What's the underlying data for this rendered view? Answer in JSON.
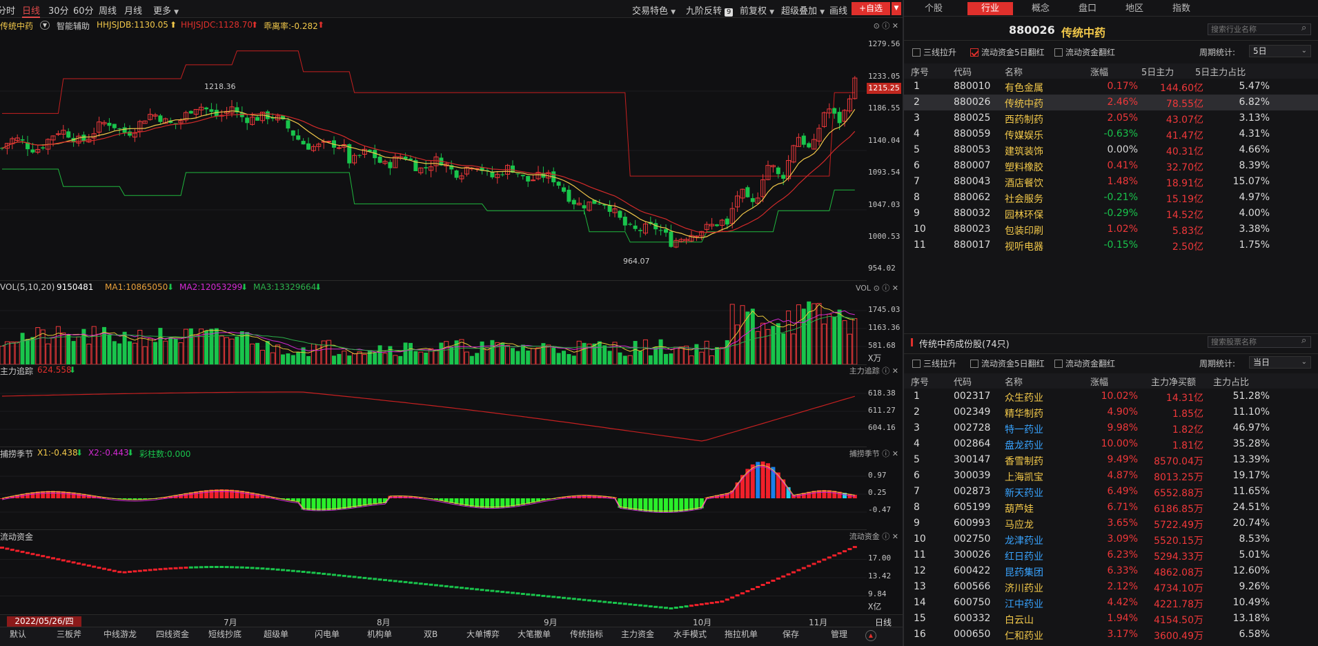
{
  "toolbar": {
    "periods": [
      "分时",
      "日线",
      "30分",
      "60分",
      "周线",
      "月线",
      "更多"
    ],
    "active_period": "日线",
    "right_items": [
      "交易特色",
      "九阶反转",
      "前复权",
      "超级叠加",
      "画线"
    ],
    "badge": "9",
    "add_fav": "+自选"
  },
  "kline": {
    "name": "传统中药",
    "assist": "智能辅助",
    "hh1": "HHJSJDB:1130.05",
    "hh2": "HHJSJDC:1128.70",
    "bias": "乖离率:-0.282",
    "axis": [
      "1279.56",
      "1233.05",
      "1186.55",
      "1140.04",
      "1093.54",
      "1047.03",
      "1000.53",
      "954.02"
    ],
    "current": "1215.25",
    "high_label": "1218.36",
    "low_label": "964.07"
  },
  "vol": {
    "title": "VOL(5,10,20)",
    "value": "9150481",
    "ma1": "MA1:10865050",
    "ma2": "MA2:12053299",
    "ma3": "MA3:13329664",
    "tag": "VOL",
    "axis": [
      "1745.03",
      "1163.36",
      "581.68"
    ],
    "unit": "X万"
  },
  "trace": {
    "title": "主力追踪",
    "value": "624.558",
    "tag": "主力追踪",
    "axis": [
      "618.38",
      "611.27",
      "604.16"
    ]
  },
  "season": {
    "title": "捕捞季节",
    "x1": "X1:-0.438",
    "x2": "X2:-0.443",
    "bars": "彩柱数:0.000",
    "tag": "捕捞季节",
    "axis": [
      "0.97",
      "0.25",
      "-0.47"
    ]
  },
  "flow": {
    "title": "流动资金",
    "tag": "流动资金",
    "axis": [
      "17.00",
      "13.42",
      "9.84"
    ],
    "unit": "X亿"
  },
  "xaxis": {
    "date": "2022/05/26/四",
    "months": [
      "7月",
      "8月",
      "9月",
      "10月",
      "11月"
    ],
    "period": "日线"
  },
  "bottom_tabs": [
    "默认",
    "三板斧",
    "中线游龙",
    "四线资金",
    "短线抄底",
    "超级单",
    "闪电单",
    "机构单",
    "双B",
    "大单博弈",
    "大笔撤单",
    "传统指标",
    "主力资金",
    "水手模式",
    "拖拉机单",
    "保存",
    "管理"
  ],
  "right": {
    "tabs": [
      "个股",
      "行业",
      "概念",
      "盘口",
      "地区",
      "指数"
    ],
    "active_tab": "行业",
    "code": "880026",
    "name": "传统中药",
    "search_industry": "搜索行业名称",
    "cb1": [
      "三线拉升",
      "流动资金5日翻红",
      "流动资金翻红"
    ],
    "period_label": "周期统计:",
    "period_value": "5日",
    "headers": [
      "序号",
      "代码",
      "名称",
      "涨幅",
      "5日主力",
      "5日主力占比"
    ],
    "rows": [
      {
        "no": "1",
        "code": "880010",
        "name": "有色金属",
        "chg": "0.17%",
        "main": "144.60亿",
        "ratio": "5.47%",
        "dir": "up"
      },
      {
        "no": "2",
        "code": "880026",
        "name": "传统中药",
        "chg": "2.46%",
        "main": "78.55亿",
        "ratio": "6.82%",
        "dir": "up"
      },
      {
        "no": "3",
        "code": "880025",
        "name": "西药制药",
        "chg": "2.05%",
        "main": "43.07亿",
        "ratio": "3.13%",
        "dir": "up"
      },
      {
        "no": "4",
        "code": "880059",
        "name": "传媒娱乐",
        "chg": "-0.63%",
        "main": "41.47亿",
        "ratio": "4.31%",
        "dir": "dn"
      },
      {
        "no": "5",
        "code": "880053",
        "name": "建筑装饰",
        "chg": "0.00%",
        "main": "40.31亿",
        "ratio": "4.66%",
        "dir": "zr"
      },
      {
        "no": "6",
        "code": "880007",
        "name": "塑料橡胶",
        "chg": "0.41%",
        "main": "32.70亿",
        "ratio": "8.39%",
        "dir": "up"
      },
      {
        "no": "7",
        "code": "880043",
        "name": "酒店餐饮",
        "chg": "1.48%",
        "main": "18.91亿",
        "ratio": "15.07%",
        "dir": "up"
      },
      {
        "no": "8",
        "code": "880062",
        "name": "社会服务",
        "chg": "-0.21%",
        "main": "15.19亿",
        "ratio": "4.97%",
        "dir": "dn"
      },
      {
        "no": "9",
        "code": "880032",
        "name": "园林环保",
        "chg": "-0.29%",
        "main": "14.52亿",
        "ratio": "4.00%",
        "dir": "dn"
      },
      {
        "no": "10",
        "code": "880023",
        "name": "包装印刷",
        "chg": "1.02%",
        "main": "5.83亿",
        "ratio": "3.38%",
        "dir": "up"
      },
      {
        "no": "11",
        "code": "880017",
        "name": "视听电器",
        "chg": "-0.15%",
        "main": "2.50亿",
        "ratio": "1.75%",
        "dir": "dn"
      }
    ],
    "constituents_title": "传统中药成份股(74只)",
    "search_stock": "搜索股票名称",
    "cb2": [
      "三线拉升",
      "流动资金5日翻红",
      "流动资金翻红"
    ],
    "period2_value": "当日",
    "headers2": [
      "序号",
      "代码",
      "名称",
      "涨幅",
      "主力净买额",
      "主力占比"
    ],
    "rows2": [
      {
        "no": "1",
        "code": "002317",
        "name": "众生药业",
        "chg": "10.02%",
        "main": "14.31亿",
        "ratio": "51.28%",
        "nc": "yl"
      },
      {
        "no": "2",
        "code": "002349",
        "name": "精华制药",
        "chg": "4.90%",
        "main": "1.85亿",
        "ratio": "11.10%",
        "nc": "yl"
      },
      {
        "no": "3",
        "code": "002728",
        "name": "特一药业",
        "chg": "9.98%",
        "main": "1.82亿",
        "ratio": "46.97%",
        "nc": "bl"
      },
      {
        "no": "4",
        "code": "002864",
        "name": "盘龙药业",
        "chg": "10.00%",
        "main": "1.81亿",
        "ratio": "35.28%",
        "nc": "bl"
      },
      {
        "no": "5",
        "code": "300147",
        "name": "香雪制药",
        "chg": "9.49%",
        "main": "8570.04万",
        "ratio": "13.39%",
        "nc": "yl"
      },
      {
        "no": "6",
        "code": "300039",
        "name": "上海凯宝",
        "chg": "4.87%",
        "main": "8013.25万",
        "ratio": "19.17%",
        "nc": "yl"
      },
      {
        "no": "7",
        "code": "002873",
        "name": "新天药业",
        "chg": "6.49%",
        "main": "6552.88万",
        "ratio": "11.65%",
        "nc": "bl"
      },
      {
        "no": "8",
        "code": "605199",
        "name": "葫芦娃",
        "chg": "6.71%",
        "main": "6186.85万",
        "ratio": "24.51%",
        "nc": "yl"
      },
      {
        "no": "9",
        "code": "600993",
        "name": "马应龙",
        "chg": "3.65%",
        "main": "5722.49万",
        "ratio": "20.74%",
        "nc": "yl"
      },
      {
        "no": "10",
        "code": "002750",
        "name": "龙津药业",
        "chg": "3.09%",
        "main": "5520.15万",
        "ratio": "8.53%",
        "nc": "bl"
      },
      {
        "no": "11",
        "code": "300026",
        "name": "红日药业",
        "chg": "6.23%",
        "main": "5294.33万",
        "ratio": "5.01%",
        "nc": "bl"
      },
      {
        "no": "12",
        "code": "600422",
        "name": "昆药集团",
        "chg": "6.33%",
        "main": "4862.08万",
        "ratio": "12.60%",
        "nc": "bl"
      },
      {
        "no": "13",
        "code": "600566",
        "name": "济川药业",
        "chg": "2.12%",
        "main": "4734.10万",
        "ratio": "9.26%",
        "nc": "yl"
      },
      {
        "no": "14",
        "code": "600750",
        "name": "江中药业",
        "chg": "4.42%",
        "main": "4221.78万",
        "ratio": "10.49%",
        "nc": "bl"
      },
      {
        "no": "15",
        "code": "600332",
        "name": "白云山",
        "chg": "1.94%",
        "main": "4154.50万",
        "ratio": "13.18%",
        "nc": "yl"
      },
      {
        "no": "16",
        "code": "000650",
        "name": "仁和药业",
        "chg": "3.17%",
        "main": "3600.49万",
        "ratio": "6.58%",
        "nc": "yl"
      }
    ]
  },
  "colors": {
    "up": "#f0383a",
    "down": "#19c44c",
    "accent": "#e0302c",
    "ma1": "#e8c63a",
    "ma2": "#d42ad4",
    "ma3": "#2bb04a"
  }
}
